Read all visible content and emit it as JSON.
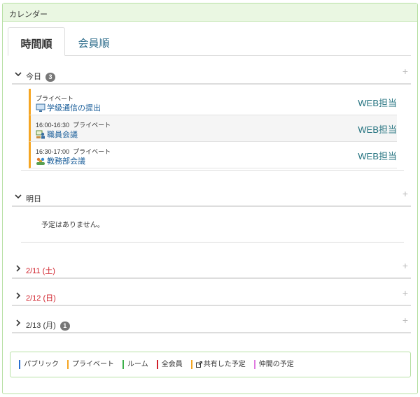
{
  "panel": {
    "title": "カレンダー"
  },
  "tabs": [
    {
      "label": "時間順",
      "active": true
    },
    {
      "label": "会員順",
      "active": false
    }
  ],
  "days": [
    {
      "label": "今日",
      "badge": "3",
      "expanded": true,
      "color": "#333333"
    },
    {
      "label": "明日",
      "badge": null,
      "expanded": true,
      "color": "#333333"
    },
    {
      "label": "2/11 (土)",
      "badge": null,
      "expanded": false,
      "color": "#d0202a"
    },
    {
      "label": "2/12 (日)",
      "badge": null,
      "expanded": false,
      "color": "#d0202a"
    },
    {
      "label": "2/13 (月)",
      "badge": "1",
      "expanded": false,
      "color": "#333333"
    }
  ],
  "plus": "+",
  "today_events": [
    {
      "time": "",
      "category": "プライベート",
      "title": "学級通信の提出",
      "owner": "WEB担当",
      "icon": "monitor-icon"
    },
    {
      "time": "16:00-16:30",
      "category": "プライベート",
      "title": "職員会議",
      "owner": "WEB担当",
      "icon": "meeting-icon"
    },
    {
      "time": "16:30-17:00",
      "category": "プライベート",
      "title": "教務部会議",
      "owner": "WEB担当",
      "icon": "group-icon"
    }
  ],
  "tomorrow_empty": "予定はありません。",
  "legend": [
    {
      "label": "パブリック",
      "color": "#2a6fd0"
    },
    {
      "label": "プライベート",
      "color": "#f5a623"
    },
    {
      "label": "ルーム",
      "color": "#3cb04a"
    },
    {
      "label": "全会員",
      "color": "#d0202a"
    },
    {
      "label": "共有した予定",
      "color": "#f5a623",
      "icon": "share-icon"
    },
    {
      "label": "仲間の予定",
      "color": "#e07ae0"
    }
  ]
}
